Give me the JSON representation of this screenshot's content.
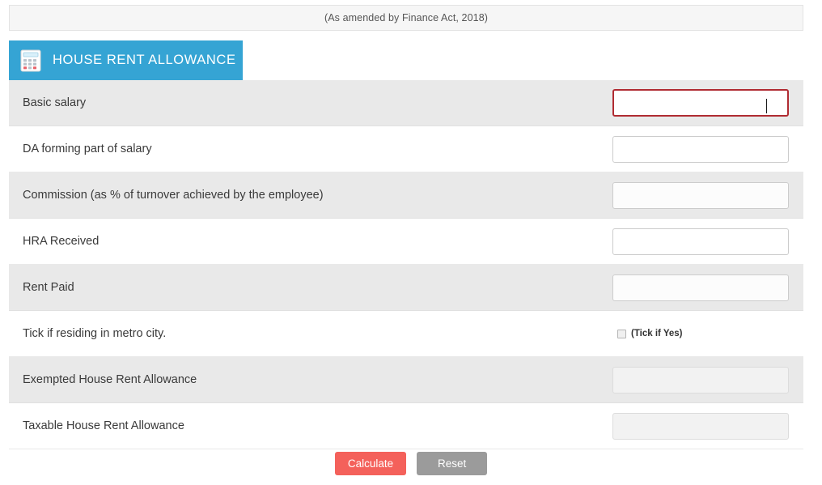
{
  "banner": {
    "text": "(As amended by Finance Act, 2018)"
  },
  "tab": {
    "title": "HOUSE RENT ALLOWANCE",
    "icon": "calculator-icon",
    "background_color": "#35a4d4"
  },
  "form": {
    "rows": [
      {
        "label": "Basic salary",
        "control": "input",
        "value": "",
        "state": "focused-error"
      },
      {
        "label": "DA forming part of salary",
        "control": "input",
        "value": "",
        "state": "normal"
      },
      {
        "label": "Commission (as % of turnover achieved by the employee)",
        "control": "input",
        "value": "",
        "state": "normal"
      },
      {
        "label": "HRA Received",
        "control": "input",
        "value": "",
        "state": "normal"
      },
      {
        "label": "Rent Paid",
        "control": "input",
        "value": "",
        "state": "normal"
      },
      {
        "label": "Tick if residing in metro city.",
        "control": "checkbox",
        "value": "",
        "state": "unchecked",
        "checkbox_label": "(Tick if Yes)"
      },
      {
        "label": "Exempted House Rent Allowance",
        "control": "input",
        "value": "",
        "state": "readonly"
      },
      {
        "label": "Taxable House Rent Allowance",
        "control": "input",
        "value": "",
        "state": "readonly"
      }
    ]
  },
  "buttons": {
    "calculate": "Calculate",
    "reset": "Reset",
    "calculate_color": "#f4615b",
    "reset_color": "#9b9b9b"
  },
  "colors": {
    "accent": "#35a4d4",
    "error_border": "#b02b32",
    "row_shaded": "#e9e9e9",
    "row_plain": "#ffffff"
  }
}
